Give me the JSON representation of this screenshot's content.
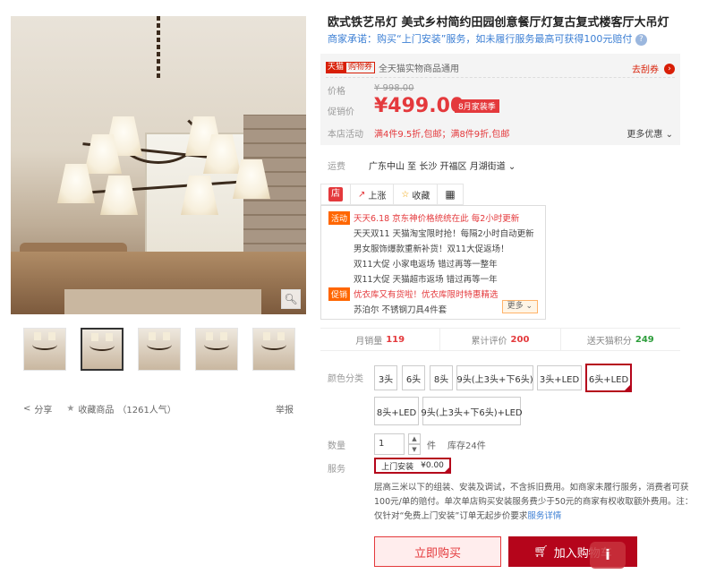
{
  "gallery": {
    "zoom_icon": "search-icon",
    "thumb_count": 5,
    "active_index": 1
  },
  "actions": {
    "share": "分享",
    "favorite": "收藏商品",
    "favorite_count": "（1261人气）",
    "report": "举报"
  },
  "product": {
    "title": "欧式铁艺吊灯 美式乡村简约田园创意餐厅灯复古复式楼客厅大吊灯",
    "promise": "商家承诺：购买“上门安装”服务，如未履行服务最高可获得100元赔付"
  },
  "price_box": {
    "tag1": "天猫",
    "tag2": "购物券",
    "coupon_text": "全天猫实物商品通用",
    "go_coupon": "去刮券",
    "price_label": "价格",
    "old_price": "¥ 998.00",
    "promo_label": "促销价",
    "promo_price": "¥499.00",
    "promo_tag": "8月家装季",
    "store_label": "本店活动",
    "store_offer": "满4件9.5折,包邮；满8件9折,包邮",
    "more_offers": "更多优惠"
  },
  "shipping": {
    "label": "运费",
    "value": "广东中山  至 长沙 开福区 月湖街道"
  },
  "act_tabs": {
    "shop_icon": "店",
    "up": "上涨",
    "fav": "收藏",
    "qr": "qr-code-icon"
  },
  "activities": {
    "badge1": "活动",
    "line1": "天天6.18 京东神价格统统在此 每2小时更新",
    "line2": "天天双11 天猫淘宝限时抢！每隔2小时自动更新",
    "line3": "男女服饰爆款重新补货！双11大促返场！",
    "line4": "双11大促 小家电返场 错过再等一整年",
    "line5": "双11大促 天猫超市返场 错过再等一年",
    "badge2": "促销",
    "line6": "优衣库又有货啦！优衣库限时特惠精选",
    "line7": "苏泊尔 不锈钢刀具4件套",
    "more": "更多"
  },
  "stats": {
    "monthly_label": "月销量",
    "monthly_value": "119",
    "review_label": "累计评价",
    "review_value": "200",
    "points_label": "送天猫积分",
    "points_value": "249"
  },
  "options": {
    "color_label": "颜色分类",
    "items": [
      "3头",
      "6头",
      "8头",
      "9头(上3头+下6头)",
      "3头+LED",
      "6头+LED",
      "8头+LED",
      "9头(上3头+下6头)+LED"
    ],
    "selected": "6头+LED"
  },
  "quantity": {
    "label": "数量",
    "value": "1",
    "unit": "件",
    "stock": "库存24件"
  },
  "service": {
    "label": "服务",
    "option_name": "上门安装",
    "option_price": "¥0.00",
    "desc": "层高三米以下的组装、安装及调试，不含拆旧费用。如商家未履行服务，消费者可获100元/单的赔付。单次单店购买安装服务费少于50元的商家有权收取额外费用。注：仅针对“免费上门安装”订单无起步价要求",
    "detail_link": "服务详情"
  },
  "buttons": {
    "buy_now": "立即购买",
    "add_cart": "加入购物车"
  },
  "colors": {
    "tmall_red": "#b5051b",
    "price_red": "#e4393c",
    "link_blue": "#3c7fd4",
    "stat_green": "#2e9e3c",
    "stat_orange": "#f60"
  }
}
